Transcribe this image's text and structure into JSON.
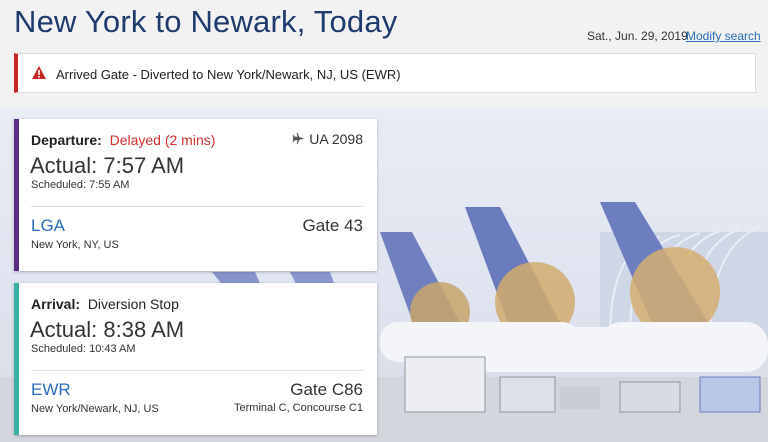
{
  "header": {
    "title": "New York to Newark, Today",
    "date": "Sat., Jun. 29, 2019",
    "modify_label": "Modify search"
  },
  "alert": {
    "icon": "warning-icon",
    "text": "Arrived Gate - Diverted to New York/Newark, NJ, US (EWR)",
    "color": "#c62828"
  },
  "departure": {
    "label": "Departure:",
    "status": "Delayed (2 mins)",
    "flight": "UA 2098",
    "actual": "Actual: 7:57 AM",
    "scheduled": "Scheduled: 7:55 AM",
    "airport_code": "LGA",
    "airport_city": "New York, NY, US",
    "gate": "Gate 43",
    "accent": "#5b2d82"
  },
  "arrival": {
    "label": "Arrival:",
    "status": "Diversion Stop",
    "actual": "Actual: 8:38 AM",
    "scheduled": "Scheduled: 10:43 AM",
    "airport_code": "EWR",
    "airport_city": "New York/Newark, NJ, US",
    "gate": "Gate C86",
    "terminal": "Terminal C, Concourse C1",
    "accent": "#3ab0a6"
  }
}
